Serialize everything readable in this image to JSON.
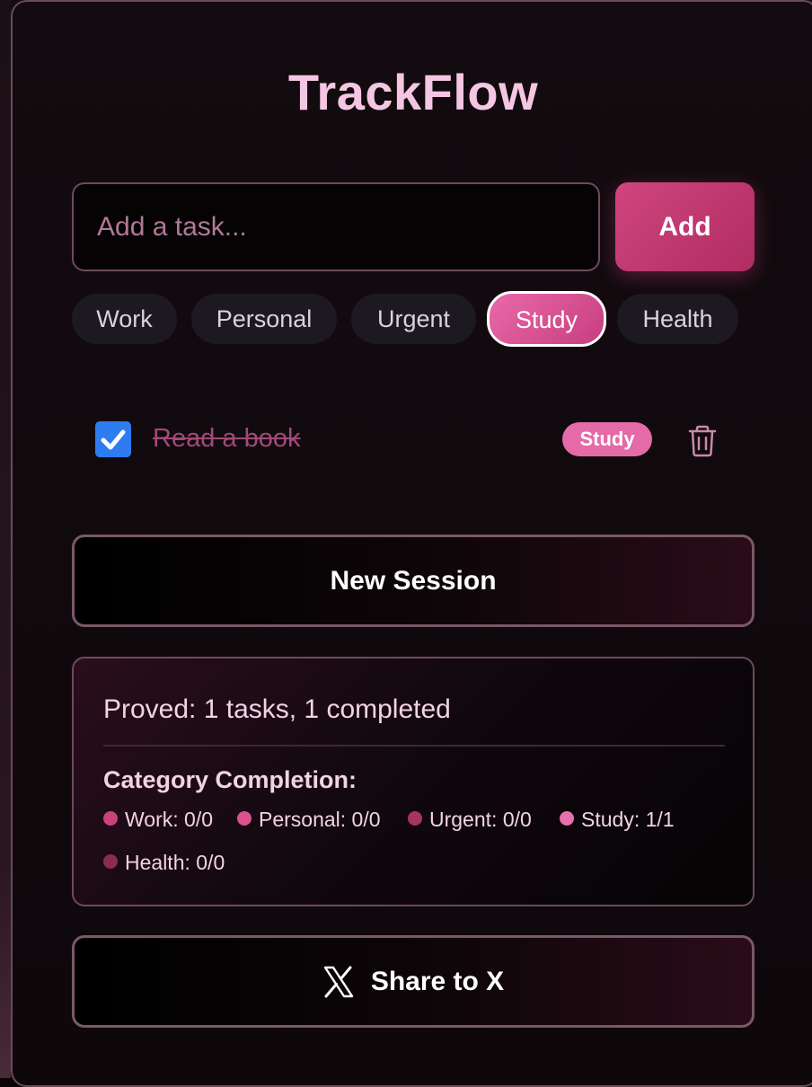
{
  "app": {
    "title": "TrackFlow"
  },
  "input": {
    "placeholder": "Add a task...",
    "value": ""
  },
  "add_button": {
    "label": "Add"
  },
  "categories": [
    {
      "label": "Work",
      "active": false
    },
    {
      "label": "Personal",
      "active": false
    },
    {
      "label": "Urgent",
      "active": false
    },
    {
      "label": "Study",
      "active": true
    },
    {
      "label": "Health",
      "active": false
    }
  ],
  "tasks": [
    {
      "text": "Read a book",
      "completed": true,
      "category": "Study",
      "category_color": "#e56aa8"
    }
  ],
  "new_session_button": {
    "label": "New Session"
  },
  "stats": {
    "summary": "Proved: 1 tasks, 1 completed",
    "heading": "Category Completion:",
    "items": [
      {
        "label": "Work: 0/0",
        "color": "#c9427c"
      },
      {
        "label": "Personal: 0/0",
        "color": "#d9528d"
      },
      {
        "label": "Urgent: 0/0",
        "color": "#a63462"
      },
      {
        "label": "Study: 1/1",
        "color": "#e870ac"
      },
      {
        "label": "Health: 0/0",
        "color": "#8a2c52"
      }
    ]
  },
  "share_button": {
    "label": "Share to X",
    "icon": "x-logo-icon"
  },
  "colors": {
    "accent": "#d0457f",
    "title": "#f5c6e3",
    "checkbox": "#2f7bf0"
  }
}
